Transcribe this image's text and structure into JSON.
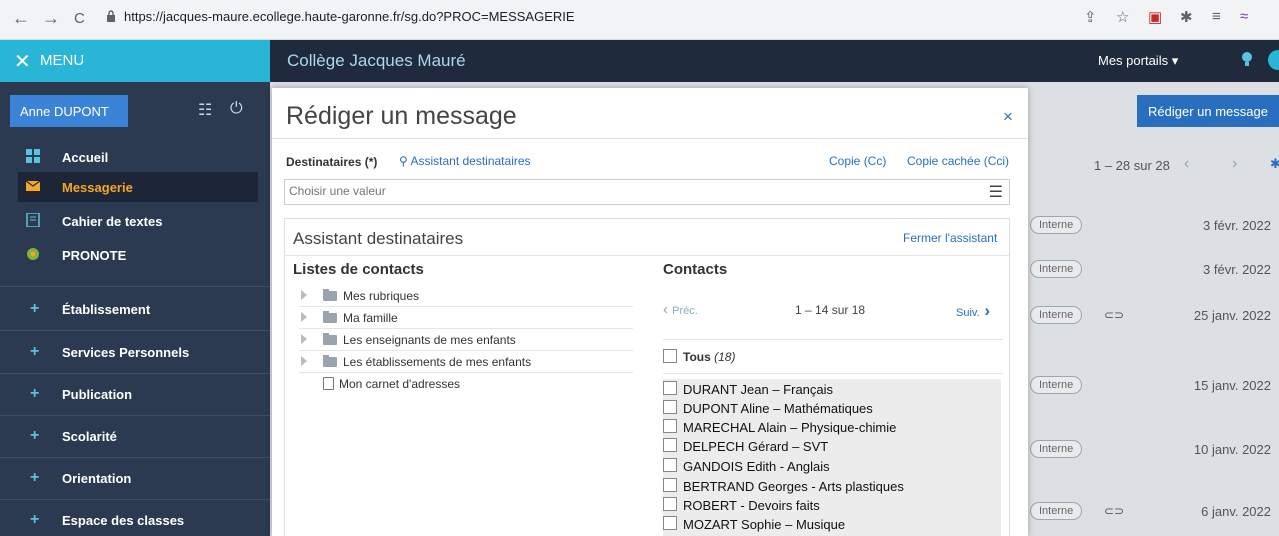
{
  "browser": {
    "url": "https://jacques-maure.ecollege.haute-garonne.fr/sg.do?PROC=MESSAGERIE",
    "back_icon": "←",
    "forward_icon": "→",
    "reload_icon": "C"
  },
  "header": {
    "menu_label": "MENU",
    "school": "Collège Jacques Mauré",
    "portails": "Mes portails ▾"
  },
  "sidebar": {
    "user": "Anne DUPONT",
    "items": [
      {
        "label": "Accueil",
        "icon": "grid-icon",
        "color": "#5cc2e0"
      },
      {
        "label": "Messagerie",
        "icon": "envelope-icon",
        "color": "#f5a623"
      },
      {
        "label": "Cahier de textes",
        "icon": "notebook-icon",
        "color": "#5cc2e0"
      },
      {
        "label": "PRONOTE",
        "icon": "pronote-icon",
        "color": "#7cb342"
      }
    ],
    "sections": [
      "Établissement",
      "Services Personnels",
      "Publication",
      "Scolarité",
      "Orientation",
      "Espace des classes"
    ]
  },
  "main": {
    "compose_button": "Rédiger un message",
    "pagination": "1 – 28 sur 28",
    "messages": [
      {
        "tag": "Interne",
        "attach": false,
        "date": "3 févr. 2022"
      },
      {
        "tag": "Interne",
        "attach": false,
        "date": "3 févr. 2022"
      },
      {
        "tag": "Interne",
        "attach": true,
        "date": "25 janv. 2022"
      },
      {
        "tag": "Interne",
        "attach": false,
        "date": "15 janv. 2022"
      },
      {
        "tag": "Interne",
        "attach": false,
        "date": "10 janv. 2022"
      },
      {
        "tag": "Interne",
        "attach": true,
        "date": "6 janv. 2022"
      }
    ]
  },
  "modal": {
    "title": "Rédiger un message",
    "close": "×",
    "recipients_label": "Destinataires (*)",
    "assistant_link": "Assistant destinataires",
    "cc": "Copie (Cc)",
    "cci": "Copie cachée (Cci)",
    "choose_placeholder": "Choisir une valeur",
    "assistant": {
      "title": "Assistant destinataires",
      "close_link": "Fermer l'assistant",
      "lists_title": "Listes de contacts",
      "lists": [
        "Mes rubriques",
        "Ma famille",
        "Les enseignants de mes enfants",
        "Les établissements de mes enfants"
      ],
      "address_book": "Mon carnet d'adresses",
      "contacts_title": "Contacts",
      "prev": "Préc.",
      "next": "Suiv.",
      "range": "1 – 14 sur 18",
      "all_label": "Tous",
      "all_count": "(18)",
      "contacts": [
        "DURANT Jean – Français",
        "DUPONT Aline – Mathématiques",
        "MARECHAL Alain – Physique-chimie",
        "DELPECH Gérard – SVT",
        "GANDOIS Edith - Anglais",
        "BERTRAND Georges - Arts plastiques",
        "ROBERT - Devoirs faits",
        "MOZART Sophie – Musique"
      ]
    }
  }
}
